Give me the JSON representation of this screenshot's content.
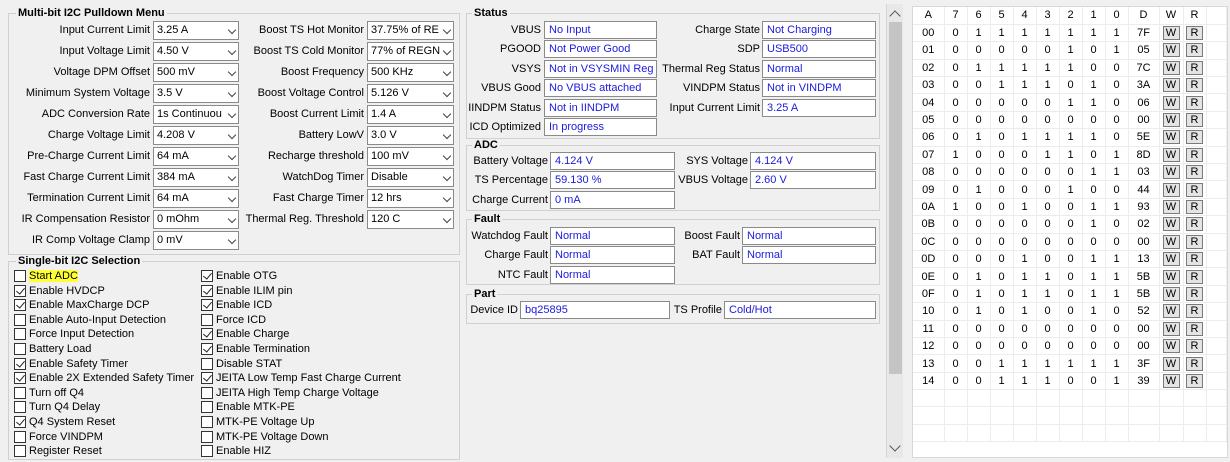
{
  "multibit": {
    "title": "Multi-bit I2C Pulldown Menu",
    "left_fields": [
      {
        "label": "Input Current Limit",
        "value": "3.25 A"
      },
      {
        "label": "Input Voltage Limit",
        "value": "4.50 V"
      },
      {
        "label": "Voltage DPM Offset",
        "value": "500 mV"
      },
      {
        "label": "Minimum System Voltage",
        "value": "3.5 V"
      },
      {
        "label": "ADC Conversion Rate",
        "value": "1s Continuou"
      },
      {
        "label": "Charge Voltage Limit",
        "value": "4.208 V"
      },
      {
        "label": "Pre-Charge Current Limit",
        "value": "64 mA"
      },
      {
        "label": "Fast Charge Current Limit",
        "value": "384 mA"
      },
      {
        "label": "Termination Current Limit",
        "value": "64 mA"
      },
      {
        "label": "IR Compensation Resistor",
        "value": "0 mOhm"
      },
      {
        "label": "IR Comp Voltage Clamp",
        "value": "0 mV"
      }
    ],
    "right_fields": [
      {
        "label": "Boost TS Hot Monitor",
        "value": "37.75% of RE"
      },
      {
        "label": "Boost TS Cold Monitor",
        "value": "77% of REGN"
      },
      {
        "label": "Boost Frequency",
        "value": "500 KHz"
      },
      {
        "label": "Boost Voltage Control",
        "value": "5.126 V"
      },
      {
        "label": "Boost Current Limit",
        "value": "1.4 A"
      },
      {
        "label": "Battery LowV",
        "value": "3.0 V"
      },
      {
        "label": "Recharge threshold",
        "value": "100 mV"
      },
      {
        "label": "WatchDog Timer",
        "value": "Disable"
      },
      {
        "label": "Fast Charge Timer",
        "value": "12 hrs"
      },
      {
        "label": "Thermal Reg. Threshold",
        "value": "120 C"
      }
    ]
  },
  "singlebit": {
    "title": "Single-bit I2C Selection",
    "col1": [
      {
        "label": "Start ADC",
        "checked": false,
        "highlight": true
      },
      {
        "label": "Enable HVDCP",
        "checked": true
      },
      {
        "label": "Enable MaxCharge DCP",
        "checked": true
      },
      {
        "label": "Enable Auto-Input Detection",
        "checked": false
      },
      {
        "label": "Force Input Detection",
        "checked": false
      },
      {
        "label": "Battery Load",
        "checked": false
      },
      {
        "label": "Enable Safety Timer",
        "checked": true
      },
      {
        "label": "Enable 2X Extended Safety Timer",
        "checked": true
      },
      {
        "label": "Turn off Q4",
        "checked": false
      },
      {
        "label": "Turn Q4 Delay",
        "checked": false
      },
      {
        "label": "Q4 System Reset",
        "checked": true
      },
      {
        "label": "Force VINDPM",
        "checked": false
      },
      {
        "label": "Register Reset",
        "checked": false
      }
    ],
    "col2": [
      {
        "label": "Enable OTG",
        "checked": true
      },
      {
        "label": "Enable ILIM pin",
        "checked": true
      },
      {
        "label": "Enable ICD",
        "checked": true
      },
      {
        "label": "Force ICD",
        "checked": false
      },
      {
        "label": "Enable Charge",
        "checked": true
      },
      {
        "label": "Enable Termination",
        "checked": true
      },
      {
        "label": "Disable STAT",
        "checked": false
      },
      {
        "label": "JEITA Low Temp Fast Charge Current",
        "checked": true
      },
      {
        "label": "JEITA High Temp Charge Voltage",
        "checked": false
      },
      {
        "label": "Enable MTK-PE",
        "checked": false
      },
      {
        "label": "MTK-PE Voltage Up",
        "checked": false
      },
      {
        "label": "MTK-PE Voltage Down",
        "checked": false
      },
      {
        "label": "Enable HIZ",
        "checked": false
      }
    ]
  },
  "status": {
    "title": "Status",
    "left": [
      {
        "label": "VBUS",
        "value": "No Input"
      },
      {
        "label": "PGOOD",
        "value": "Not Power Good"
      },
      {
        "label": "VSYS",
        "value": "Not in VSYSMIN Reg"
      },
      {
        "label": "VBUS Good",
        "value": "No VBUS attached"
      },
      {
        "label": "IINDPM Status",
        "value": "Not in IINDPM"
      },
      {
        "label": "ICD Optimized",
        "value": "In progress"
      }
    ],
    "right": [
      {
        "label": "Charge State",
        "value": "Not Charging"
      },
      {
        "label": "SDP",
        "value": "USB500"
      },
      {
        "label": "Thermal Reg Status",
        "value": "Normal"
      },
      {
        "label": "VINDPM Status",
        "value": "Not in VINDPM"
      },
      {
        "label": "Input Current Limit",
        "value": "3.25 A"
      }
    ]
  },
  "adc": {
    "title": "ADC",
    "left": [
      {
        "label": "Battery Voltage",
        "value": "4.124 V"
      },
      {
        "label": "TS Percentage",
        "value": "59.130 %"
      },
      {
        "label": "Charge Current",
        "value": "0 mA"
      }
    ],
    "right": [
      {
        "label": "SYS Voltage",
        "value": "4.124 V"
      },
      {
        "label": "VBUS Voltage",
        "value": "2.60 V"
      }
    ]
  },
  "fault": {
    "title": "Fault",
    "left": [
      {
        "label": "Watchdog Fault",
        "value": "Normal"
      },
      {
        "label": "Charge Fault",
        "value": "Normal"
      },
      {
        "label": "NTC Fault",
        "value": "Normal"
      }
    ],
    "right": [
      {
        "label": "Boost Fault",
        "value": "Normal"
      },
      {
        "label": "BAT Fault",
        "value": "Normal"
      }
    ]
  },
  "part": {
    "title": "Part",
    "device_id_label": "Device ID",
    "device_id": "bq25895",
    "ts_profile_label": "TS Profile",
    "ts_profile": "Cold/Hot"
  },
  "register_table": {
    "headers": [
      "A",
      "7",
      "6",
      "5",
      "4",
      "3",
      "2",
      "1",
      "0",
      "D",
      "W",
      "R"
    ],
    "write_label": "W",
    "read_label": "R",
    "rows": [
      {
        "addr": "00",
        "bits": [
          "0",
          "1",
          "1",
          "1",
          "1",
          "1",
          "1",
          "1"
        ],
        "hex": "7F"
      },
      {
        "addr": "01",
        "bits": [
          "0",
          "0",
          "0",
          "0",
          "0",
          "1",
          "0",
          "1"
        ],
        "hex": "05"
      },
      {
        "addr": "02",
        "bits": [
          "0",
          "1",
          "1",
          "1",
          "1",
          "1",
          "0",
          "0"
        ],
        "hex": "7C"
      },
      {
        "addr": "03",
        "bits": [
          "0",
          "0",
          "1",
          "1",
          "1",
          "0",
          "1",
          "0"
        ],
        "hex": "3A"
      },
      {
        "addr": "04",
        "bits": [
          "0",
          "0",
          "0",
          "0",
          "0",
          "1",
          "1",
          "0"
        ],
        "hex": "06"
      },
      {
        "addr": "05",
        "bits": [
          "0",
          "0",
          "0",
          "0",
          "0",
          "0",
          "0",
          "0"
        ],
        "hex": "00"
      },
      {
        "addr": "06",
        "bits": [
          "0",
          "1",
          "0",
          "1",
          "1",
          "1",
          "1",
          "0"
        ],
        "hex": "5E"
      },
      {
        "addr": "07",
        "bits": [
          "1",
          "0",
          "0",
          "0",
          "1",
          "1",
          "0",
          "1"
        ],
        "hex": "8D"
      },
      {
        "addr": "08",
        "bits": [
          "0",
          "0",
          "0",
          "0",
          "0",
          "0",
          "1",
          "1"
        ],
        "hex": "03"
      },
      {
        "addr": "09",
        "bits": [
          "0",
          "1",
          "0",
          "0",
          "0",
          "1",
          "0",
          "0"
        ],
        "hex": "44"
      },
      {
        "addr": "0A",
        "bits": [
          "1",
          "0",
          "0",
          "1",
          "0",
          "0",
          "1",
          "1"
        ],
        "hex": "93"
      },
      {
        "addr": "0B",
        "bits": [
          "0",
          "0",
          "0",
          "0",
          "0",
          "0",
          "1",
          "0"
        ],
        "hex": "02"
      },
      {
        "addr": "0C",
        "bits": [
          "0",
          "0",
          "0",
          "0",
          "0",
          "0",
          "0",
          "0"
        ],
        "hex": "00"
      },
      {
        "addr": "0D",
        "bits": [
          "0",
          "0",
          "0",
          "1",
          "0",
          "0",
          "1",
          "1"
        ],
        "hex": "13"
      },
      {
        "addr": "0E",
        "bits": [
          "0",
          "1",
          "0",
          "1",
          "1",
          "0",
          "1",
          "1"
        ],
        "hex": "5B"
      },
      {
        "addr": "0F",
        "bits": [
          "0",
          "1",
          "0",
          "1",
          "1",
          "0",
          "1",
          "1"
        ],
        "hex": "5B"
      },
      {
        "addr": "10",
        "bits": [
          "0",
          "1",
          "0",
          "1",
          "0",
          "0",
          "1",
          "0"
        ],
        "hex": "52"
      },
      {
        "addr": "11",
        "bits": [
          "0",
          "0",
          "0",
          "0",
          "0",
          "0",
          "0",
          "0"
        ],
        "hex": "00"
      },
      {
        "addr": "12",
        "bits": [
          "0",
          "0",
          "0",
          "0",
          "0",
          "0",
          "0",
          "0"
        ],
        "hex": "00"
      },
      {
        "addr": "13",
        "bits": [
          "0",
          "0",
          "1",
          "1",
          "1",
          "1",
          "1",
          "1"
        ],
        "hex": "3F"
      },
      {
        "addr": "14",
        "bits": [
          "0",
          "0",
          "1",
          "1",
          "1",
          "0",
          "0",
          "1"
        ],
        "hex": "39"
      }
    ]
  },
  "colors": {
    "value_text": "#1a1ae0",
    "highlight": "#ffff33",
    "background": "#f0f0f0"
  }
}
